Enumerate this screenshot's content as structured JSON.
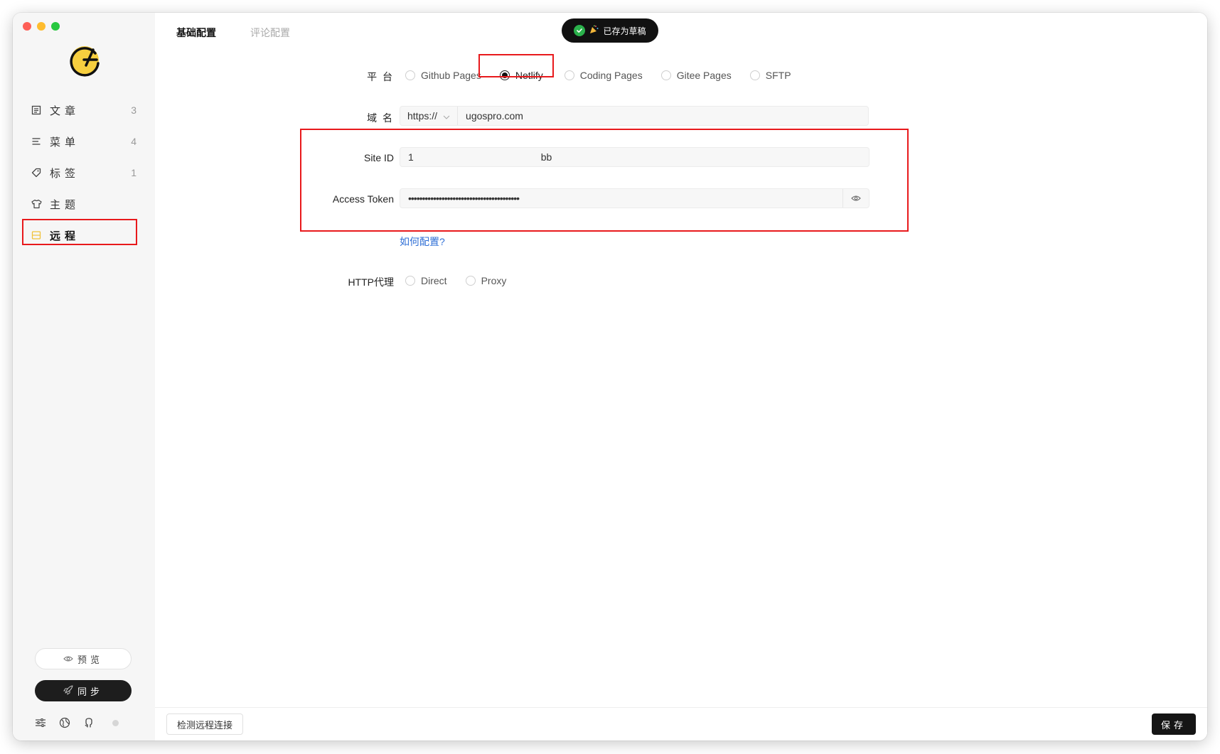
{
  "colors": {
    "accent_yellow": "#f7cf3f",
    "highlight_red": "#e8191c",
    "link_blue": "#2f6fd6",
    "sync_bg": "#1d1d1d",
    "traffic_close": "#fe5f57",
    "traffic_min": "#febc2e",
    "traffic_max": "#28c840"
  },
  "sidebar": {
    "items": [
      {
        "icon": "article-icon",
        "label": "文章",
        "count": "3"
      },
      {
        "icon": "menu-icon",
        "label": "菜单",
        "count": "4"
      },
      {
        "icon": "tag-icon",
        "label": "标签",
        "count": "1"
      },
      {
        "icon": "theme-shirt-icon",
        "label": "主题",
        "count": ""
      },
      {
        "icon": "remote-icon",
        "label": "远程",
        "count": ""
      }
    ],
    "preview_label": "预览",
    "sync_label": "同步"
  },
  "tabs": [
    "基础配置",
    "评论配置"
  ],
  "toast": {
    "text": "已存为草稿"
  },
  "form": {
    "platform": {
      "label": "平 台",
      "options": [
        "Github Pages",
        "Netlify",
        "Coding Pages",
        "Gitee Pages",
        "SFTP"
      ],
      "selected": "Netlify"
    },
    "domain": {
      "label": "域 名",
      "protocol": "https://",
      "value": "ugospro.com"
    },
    "site_id": {
      "label": "Site ID",
      "value": "1                                              bb"
    },
    "access_token": {
      "label": "Access Token",
      "value": "••••••••••••••••••••••••••••••••••••••••"
    },
    "help_link": "如何配置?",
    "proxy": {
      "label": "HTTP代理",
      "options": [
        "Direct",
        "Proxy"
      ]
    }
  },
  "footer": {
    "check_label": "检测远程连接",
    "save_label": "保存"
  }
}
